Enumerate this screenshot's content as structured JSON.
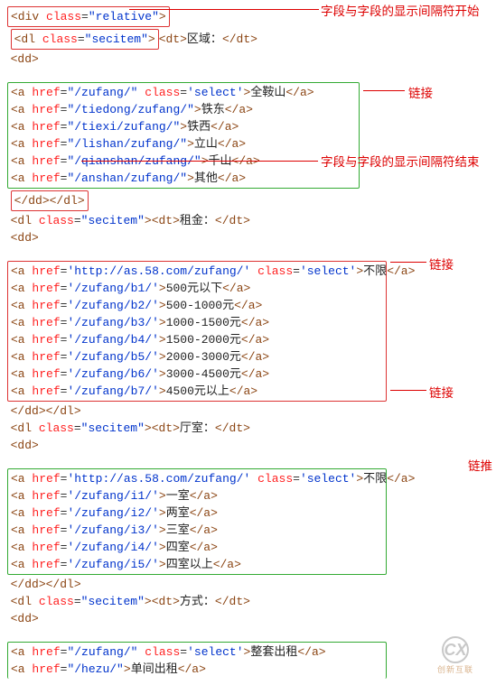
{
  "annotations": {
    "sep_start": "字段与字段的显示间隔符开始",
    "sep_end": "字段与字段的显示间隔符结束",
    "link": "链接",
    "link_short": "链推"
  },
  "code": {
    "root_open": "<div class=\"relative\">",
    "sec1_open": "<dl class=\"secitem\">",
    "sec_dt_open": "<dt>",
    "sec_dt_close": "</dt>",
    "dt1_label": "区域：",
    "dd_open": "<dd>",
    "dd_close": "</dd>",
    "dl_close": "</dl>",
    "links1": [
      {
        "href": "\"/zufang/\"",
        "extra": " class='select'",
        "label": "全鞍山"
      },
      {
        "href": "\"/tiedong/zufang/\"",
        "extra": "",
        "label": "铁东"
      },
      {
        "href": "\"/tiexi/zufang/\"",
        "extra": "",
        "label": "铁西"
      },
      {
        "href": "\"/lishan/zufang/\"",
        "extra": "",
        "label": "立山"
      },
      {
        "href": "\"/qianshan/zufang/\"",
        "extra": "",
        "label": "千山"
      },
      {
        "href": "\"/anshan/zufang/\"",
        "extra": "",
        "label": "其他"
      }
    ],
    "dt2_label": "租金：",
    "links2": [
      {
        "href": "'http://as.58.com/zufang/'",
        "extra": " class='select'",
        "label": "不限"
      },
      {
        "href": "'/zufang/b1/'",
        "extra": "",
        "label": "500元以下"
      },
      {
        "href": "'/zufang/b2/'",
        "extra": "",
        "label": "500-1000元"
      },
      {
        "href": "'/zufang/b3/'",
        "extra": "",
        "label": "1000-1500元"
      },
      {
        "href": "'/zufang/b4/'",
        "extra": "",
        "label": "1500-2000元"
      },
      {
        "href": "'/zufang/b5/'",
        "extra": "",
        "label": "2000-3000元"
      },
      {
        "href": "'/zufang/b6/'",
        "extra": "",
        "label": "3000-4500元"
      },
      {
        "href": "'/zufang/b7/'",
        "extra": "",
        "label": "4500元以上"
      }
    ],
    "dt3_label": "厅室：",
    "links3": [
      {
        "href": "'http://as.58.com/zufang/'",
        "extra": " class='select'",
        "label": "不限"
      },
      {
        "href": "'/zufang/i1/'",
        "extra": "",
        "label": "一室"
      },
      {
        "href": "'/zufang/i2/'",
        "extra": "",
        "label": "两室"
      },
      {
        "href": "'/zufang/i3/'",
        "extra": "",
        "label": "三室"
      },
      {
        "href": "'/zufang/i4/'",
        "extra": "",
        "label": "四室"
      },
      {
        "href": "'/zufang/i5/'",
        "extra": "",
        "label": "四室以上"
      }
    ],
    "dt4_label": "方式：",
    "links4": [
      {
        "href": "\"/zufang/\"",
        "extra": " class='select'",
        "label": "整套出租"
      },
      {
        "href": "\"/hezu/\"",
        "extra": "",
        "label": "单间出租"
      }
    ]
  },
  "logo": {
    "main": "CX",
    "sub": "创新互联"
  }
}
